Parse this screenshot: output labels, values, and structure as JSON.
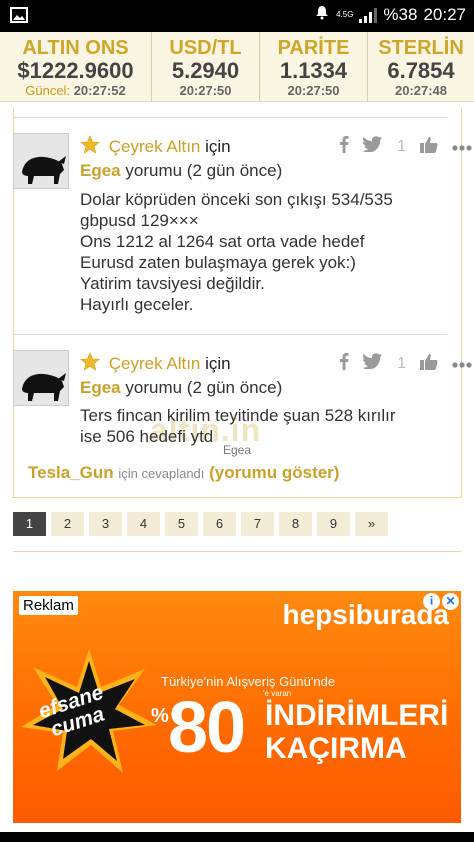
{
  "status_bar": {
    "network": "4.5G",
    "battery": "%38",
    "time": "20:27"
  },
  "ticker": [
    {
      "name": "ALTIN ONS",
      "value": "$1222.9600",
      "time_label": "Güncel:",
      "time": "20:27:52"
    },
    {
      "name": "USD/TL",
      "value": "5.2940",
      "time_label": "",
      "time": "20:27:50"
    },
    {
      "name": "PARİTE",
      "value": "1.1334",
      "time_label": "",
      "time": "20:27:50"
    },
    {
      "name": "STERLİN",
      "value": "6.7854",
      "time_label": "",
      "time": "20:27:48"
    }
  ],
  "comments": [
    {
      "title": "Çeyrek Altın",
      "title_suffix": "için",
      "author": "Egea",
      "author_suffix": "yorumu (2 gün önce)",
      "like_count": "1",
      "body": [
        "Dolar köprüden önceki son çıkışı 534/535",
        "gbpusd 129×××",
        "Ons 1212 al 1264 sat orta vade hedef",
        "Eurusd zaten bulaşmaya gerek yok:)",
        "Yatirim tavsiyesi değildir.",
        "Hayırlı geceler."
      ]
    },
    {
      "title": "Çeyrek Altın",
      "title_suffix": "için",
      "author": "Egea",
      "author_suffix": "yorumu (2 gün önce)",
      "like_count": "1",
      "body": [
        "Ters fincan kirilim teyitinde şuan 528 kırılır",
        "ise 506 hedefi ytd"
      ]
    }
  ],
  "watermark": {
    "text": "altın.in",
    "caption": "Egea"
  },
  "reply": {
    "user": "Tesla_Gun",
    "text": "için cevaplandı",
    "link": "(yorumu göster)"
  },
  "pagination": {
    "pages": [
      "1",
      "2",
      "3",
      "4",
      "5",
      "6",
      "7",
      "8",
      "9"
    ],
    "next": "»",
    "active": "1"
  },
  "ad": {
    "label": "Reklam",
    "brand": "hepsiburada",
    "burst_line1": "efsane",
    "burst_line2": "cuma",
    "subtitle": "Türkiye'nin Alışveriş Günü'nde",
    "small": "'e varan",
    "percent": "%",
    "number": "80",
    "line1": "İNDİRİMLERİ",
    "line2": "KAÇIRMA"
  }
}
